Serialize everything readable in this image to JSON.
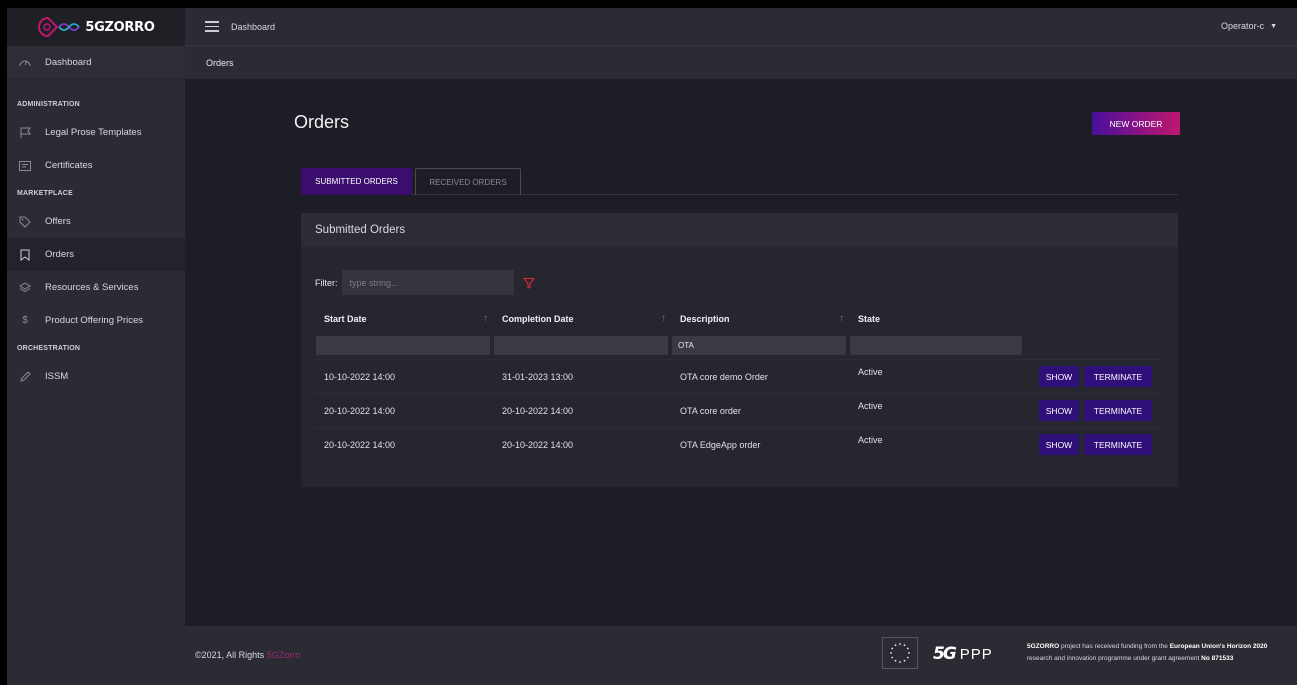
{
  "brand": {
    "name": "5GZORRO"
  },
  "header": {
    "menu_link": "Dashboard",
    "user": "Operator-c"
  },
  "breadcrumb": {
    "current": "Orders"
  },
  "sidebar": {
    "dashboard": "Dashboard",
    "sections": {
      "administration": "ADMINISTRATION",
      "marketplace": "MARKETPLACE",
      "orchestration": "ORCHESTRATION"
    },
    "items": {
      "legal": "Legal Prose Templates",
      "certificates": "Certificates",
      "offers": "Offers",
      "orders": "Orders",
      "resources": "Resources & Services",
      "prices": "Product Offering Prices",
      "issm": "ISSM"
    }
  },
  "page": {
    "title": "Orders",
    "new_order_button": "NEW ORDER",
    "tabs": {
      "submitted": "SUBMITTED ORDERS",
      "received": "RECEIVED ORDERS"
    },
    "card_title": "Submitted Orders",
    "filter": {
      "label": "Filter:",
      "placeholder": "type string..."
    },
    "columns": [
      "Start Date",
      "Completion Date",
      "Description",
      "State"
    ],
    "column_filters": [
      "",
      "",
      "OTA",
      ""
    ],
    "rows": [
      {
        "start": "10-10-2022 14:00",
        "completion": "31-01-2023 13:00",
        "description": "OTA core demo Order",
        "state": "Active"
      },
      {
        "start": "20-10-2022 14:00",
        "completion": "20-10-2022 14:00",
        "description": "OTA core order",
        "state": "Active"
      },
      {
        "start": "20-10-2022 14:00",
        "completion": "20-10-2022 14:00",
        "description": "OTA EdgeApp order",
        "state": "Active"
      }
    ],
    "actions": {
      "show": "SHOW",
      "terminate": "TERMINATE"
    }
  },
  "footer": {
    "copyright": "©2021, All Rights",
    "copyright_brand": "5GZorro",
    "ppp_mark": "5G",
    "ppp_text": "PPP",
    "funding": {
      "p1": "5GZORRO",
      "p2": " project has received funding from the ",
      "p3": "European Union's Horizon 2020",
      "p4": " research and innovation programme under grant agreement ",
      "p5": "No 871533"
    }
  },
  "colors": {
    "accent_purple": "#3b0e6e",
    "button_purple": "#2f0f7a",
    "gradient_start": "#4a0f9c",
    "gradient_end": "#c0176e",
    "brand_pink": "#a22675"
  }
}
